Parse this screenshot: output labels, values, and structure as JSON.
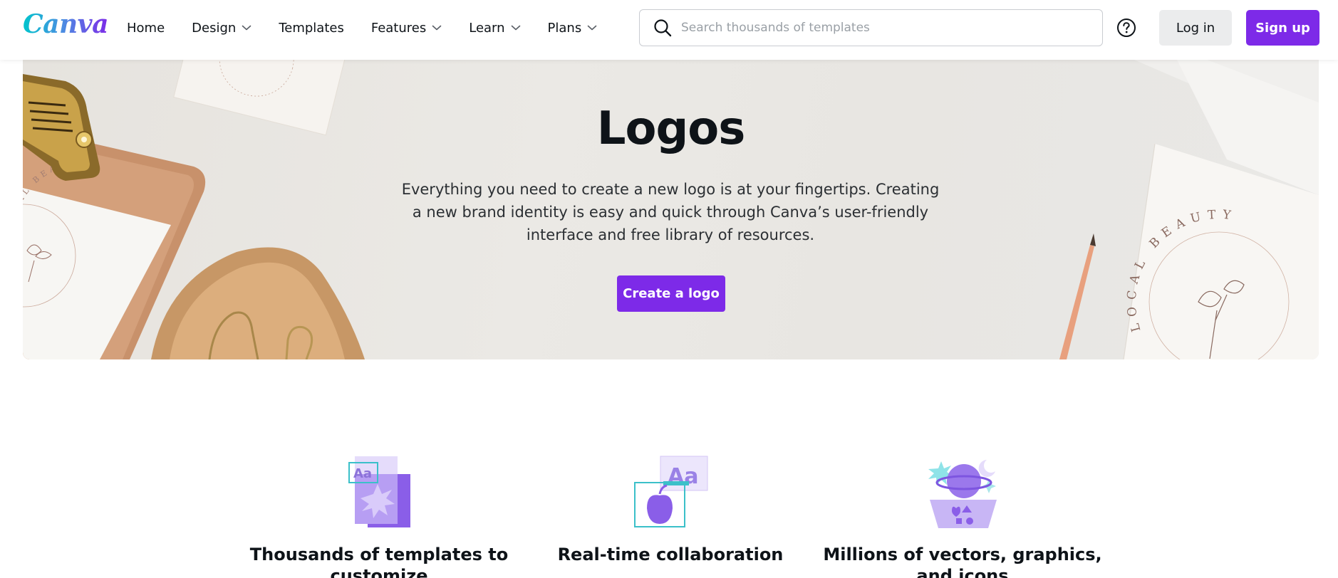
{
  "brand": {
    "name": "Canva",
    "accent": "#7d2ae8"
  },
  "nav": {
    "items": [
      {
        "label": "Home",
        "dropdown": false
      },
      {
        "label": "Design",
        "dropdown": true
      },
      {
        "label": "Templates",
        "dropdown": false
      },
      {
        "label": "Features",
        "dropdown": true
      },
      {
        "label": "Learn",
        "dropdown": true
      },
      {
        "label": "Plans",
        "dropdown": true
      }
    ]
  },
  "search": {
    "placeholder": "Search thousands of templates",
    "value": "",
    "icon": "search-icon"
  },
  "header_actions": {
    "help_icon": "question-circle-icon",
    "login_label": "Log in",
    "signup_label": "Sign up"
  },
  "hero": {
    "title": "Logos",
    "description": "Everything you need to create a new logo is at your fingertips. Creating a new brand identity is easy and quick through Canva’s user-friendly interface and free library of resources.",
    "cta_label": "Create a logo",
    "card_text_left": "LOCAL BEAUTY",
    "card_text_right": "LOCAL BEAUTY"
  },
  "features": [
    {
      "title": "Thousands of templates to customize",
      "icon": "templates-icon"
    },
    {
      "title": "Real-time collaboration",
      "icon": "collaboration-icon"
    },
    {
      "title": "Millions of vectors, graphics, and icons",
      "icon": "graphics-icon"
    }
  ]
}
